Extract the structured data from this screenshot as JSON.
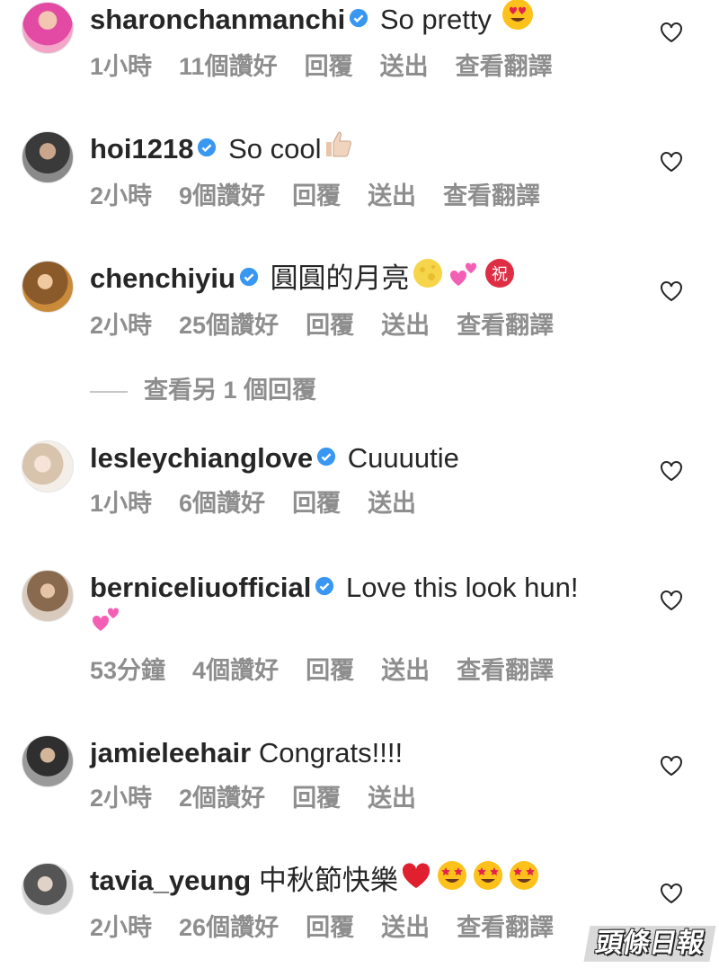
{
  "comments": [
    {
      "username": "sharonchanmanchi",
      "text": "So pretty",
      "emoji": [
        "heart-eyes-emoji"
      ],
      "time": "1小時",
      "likes": "11個讚好",
      "reply": "回覆",
      "send": "送出",
      "translate": "查看翻譯"
    },
    {
      "username": "hoi1218",
      "text": "So cool",
      "emoji": [
        "thumbs-up-emoji"
      ],
      "time": "2小時",
      "likes": "9個讚好",
      "reply": "回覆",
      "send": "送出",
      "translate": "查看翻譯"
    },
    {
      "username": "chenchiyiu",
      "text": "圓圓的月亮",
      "emoji": [
        "full-moon-emoji",
        "two-hearts-emoji",
        "congratulations-emoji"
      ],
      "time": "2小時",
      "likes": "25個讚好",
      "reply": "回覆",
      "send": "送出",
      "translate": "查看翻譯"
    },
    {
      "username": "lesleychianglove",
      "text": "Cuuuutie",
      "emoji": [],
      "time": "1小時",
      "likes": "6個讚好",
      "reply": "回覆",
      "send": "送出"
    },
    {
      "username": "berniceliuofficial",
      "text": "Love this look hun!",
      "emoji": [
        "two-hearts-emoji"
      ],
      "time": "53分鐘",
      "likes": "4個讚好",
      "reply": "回覆",
      "send": "送出",
      "translate": "查看翻譯"
    },
    {
      "username": "jamieleehair",
      "text": "Congrats!!!!",
      "emoji": [],
      "time": "2小時",
      "likes": "2個讚好",
      "reply": "回覆",
      "send": "送出"
    },
    {
      "username": "tavia_yeung",
      "text": "中秋節快樂",
      "emoji": [
        "red-heart-emoji",
        "star-struck-emoji",
        "star-struck-emoji",
        "star-struck-emoji"
      ],
      "time": "2小時",
      "likes": "26個讚好",
      "reply": "回覆",
      "send": "送出",
      "translate": "查看翻譯"
    }
  ],
  "more_replies": "查看另 1 個回覆",
  "watermark": "頭條日報",
  "colors": {
    "text": "#262626",
    "meta": "#8e8e8e",
    "verified": "#3897f0",
    "heart_outline": "#262626"
  }
}
